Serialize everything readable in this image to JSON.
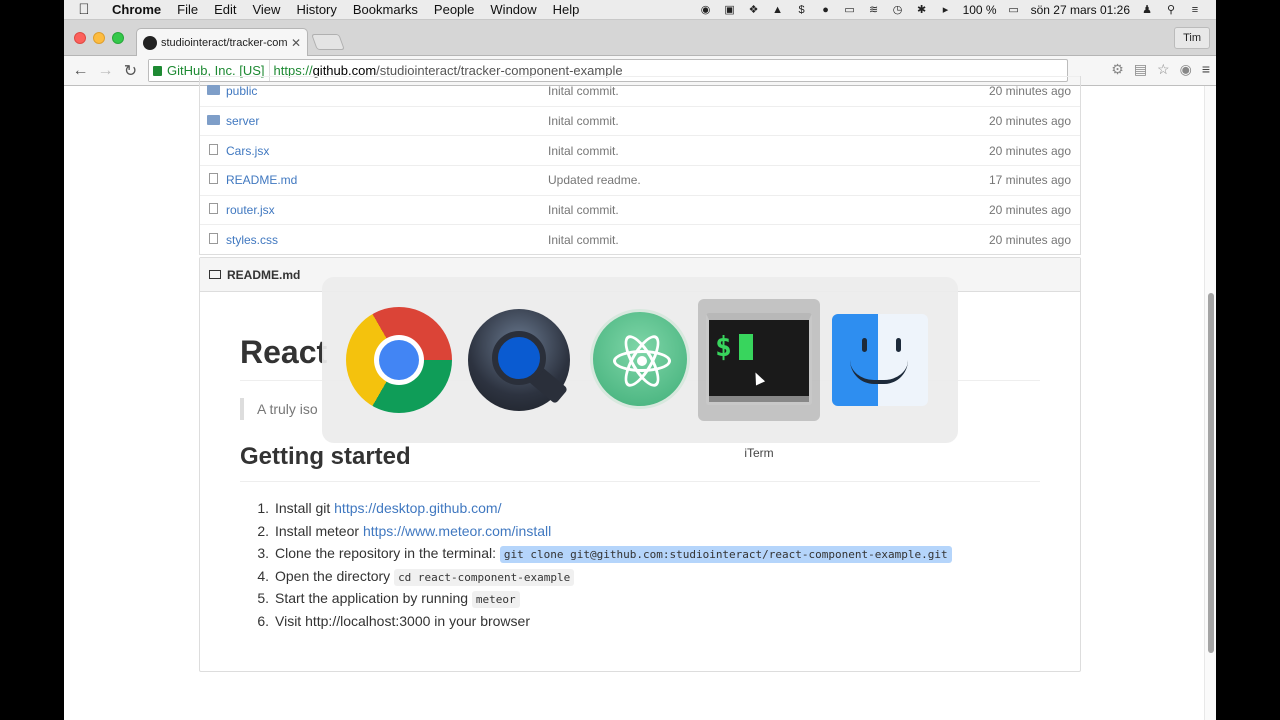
{
  "menubar": {
    "app_name": "Chrome",
    "menus": [
      "File",
      "Edit",
      "View",
      "History",
      "Bookmarks",
      "People",
      "Window",
      "Help"
    ],
    "battery": "100 %",
    "datetime": "sön 27 mars  01:26"
  },
  "browser": {
    "tab_title": "studiointeract/tracker-com",
    "profile_name": "Tim",
    "ev_label": "GitHub, Inc. [US]",
    "url_scheme": "https://",
    "url_host": "github.com",
    "url_path": "/studiointeract/tracker-component-example"
  },
  "files": [
    {
      "name": "public",
      "type": "folder",
      "message": "Inital commit.",
      "age": "20 minutes ago"
    },
    {
      "name": "server",
      "type": "folder",
      "message": "Inital commit.",
      "age": "20 minutes ago"
    },
    {
      "name": "Cars.jsx",
      "type": "file",
      "message": "Inital commit.",
      "age": "20 minutes ago"
    },
    {
      "name": "README.md",
      "type": "file",
      "message": "Updated readme.",
      "age": "17 minutes ago"
    },
    {
      "name": "router.jsx",
      "type": "file",
      "message": "Inital commit.",
      "age": "20 minutes ago"
    },
    {
      "name": "styles.css",
      "type": "file",
      "message": "Inital commit.",
      "age": "20 minutes ago"
    }
  ],
  "readme": {
    "header": "README.md",
    "title": "React",
    "quote": "A truly iso",
    "section_heading": "Getting started",
    "steps": [
      {
        "n": "1.",
        "text": "Install git ",
        "link": "https://desktop.github.com/"
      },
      {
        "n": "2.",
        "text": "Install meteor ",
        "link": "https://www.meteor.com/install"
      },
      {
        "n": "3.",
        "text": "Clone the repository in the terminal: ",
        "code": "git clone git@github.com:studiointeract/react-component-example.git"
      },
      {
        "n": "4.",
        "text": "Open the directory ",
        "code": "cd react-component-example"
      },
      {
        "n": "5.",
        "text": "Start the application by running ",
        "code": "meteor"
      },
      {
        "n": "6.",
        "text": "Visit http://localhost:3000 in your browser"
      }
    ]
  },
  "app_switcher": {
    "selected_app": "iTerm",
    "apps": [
      "chrome-icon",
      "quicktime-icon",
      "atom-icon",
      "iterm-icon",
      "finder-icon"
    ]
  }
}
